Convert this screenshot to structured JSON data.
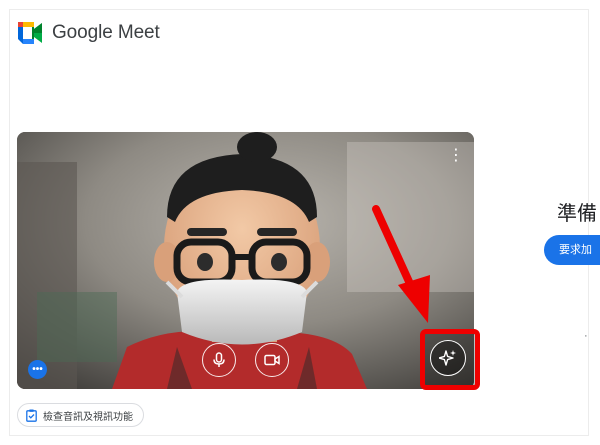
{
  "header": {
    "brand_name": "Google Meet",
    "logo_icon": "google-meet-logo",
    "brand_colors": [
      "#00832d",
      "#0066da",
      "#e94235",
      "#2684fc",
      "#00ac47",
      "#ffba00"
    ]
  },
  "preview": {
    "menu_icon": "more-vert-icon",
    "controls": [
      {
        "name": "microphone-button",
        "icon": "microphone-icon"
      },
      {
        "name": "camera-button",
        "icon": "video-camera-icon"
      }
    ],
    "more_options_icon": "more-horiz-icon",
    "effects_icon": "sparkle-icon",
    "highlight_color": "#ee0000",
    "arrow_color": "#ee0000"
  },
  "side_panel": {
    "title": "準備",
    "join_button_label": "要求加",
    "accent_color": "#1a73e8",
    "small_text": "·"
  },
  "footer": {
    "check_av_label": "檢查音訊及視訊功能",
    "check_av_icon": "clipboard-check-icon"
  }
}
